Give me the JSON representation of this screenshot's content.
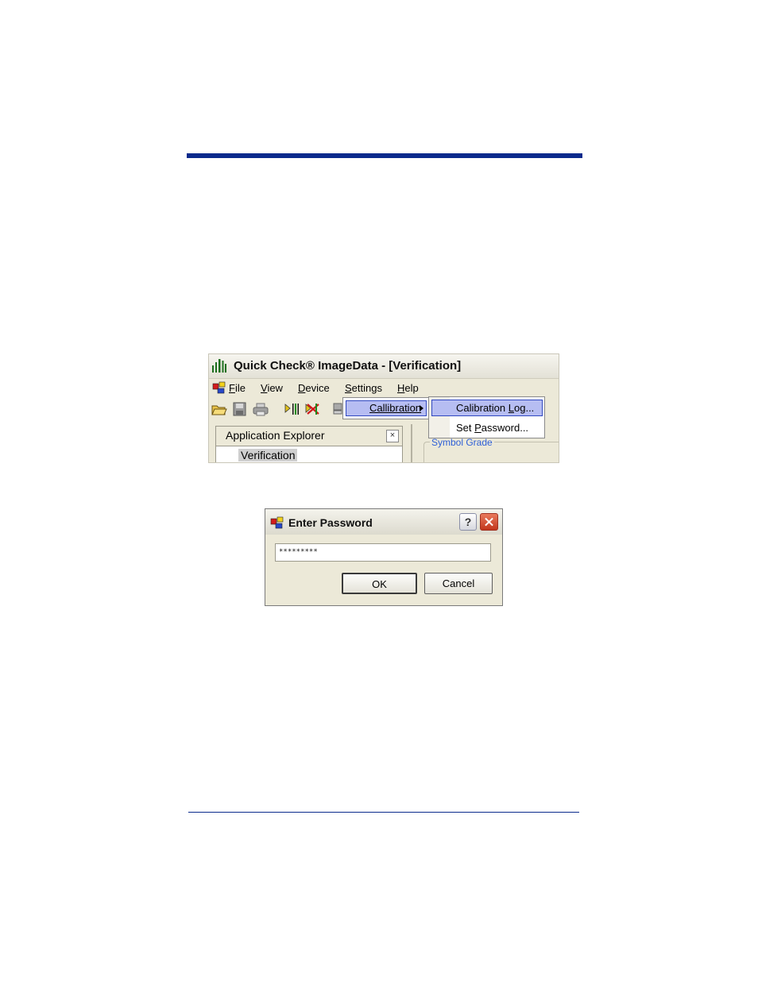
{
  "app": {
    "title": "Quick Check® ImageData - [Verification]",
    "menu": [
      {
        "first": "F",
        "rest": "ile"
      },
      {
        "first": "V",
        "rest": "iew"
      },
      {
        "first": "D",
        "rest": "evice"
      },
      {
        "first": "S",
        "rest": "ettings"
      },
      {
        "first": "H",
        "rest": "elp"
      }
    ],
    "settings_menu": {
      "item": "Callibration"
    },
    "calibration_submenu": {
      "log": {
        "before": "Calibration ",
        "accel": "L",
        "after": "og..."
      },
      "password": {
        "before": "Set ",
        "accel": "P",
        "after": "assword..."
      }
    },
    "explorer": {
      "title": "Application Explorer",
      "close": "×",
      "tree_item": "Verification"
    },
    "group_label": "Symbol Grade",
    "colors": {
      "rule": "#0a2a8c",
      "menu_highlight": "#b6bdf2",
      "link": "#2e5fd7"
    }
  },
  "dialog": {
    "title": "Enter Password",
    "help": "?",
    "password_value": "*********",
    "ok": "OK",
    "cancel": "Cancel"
  }
}
